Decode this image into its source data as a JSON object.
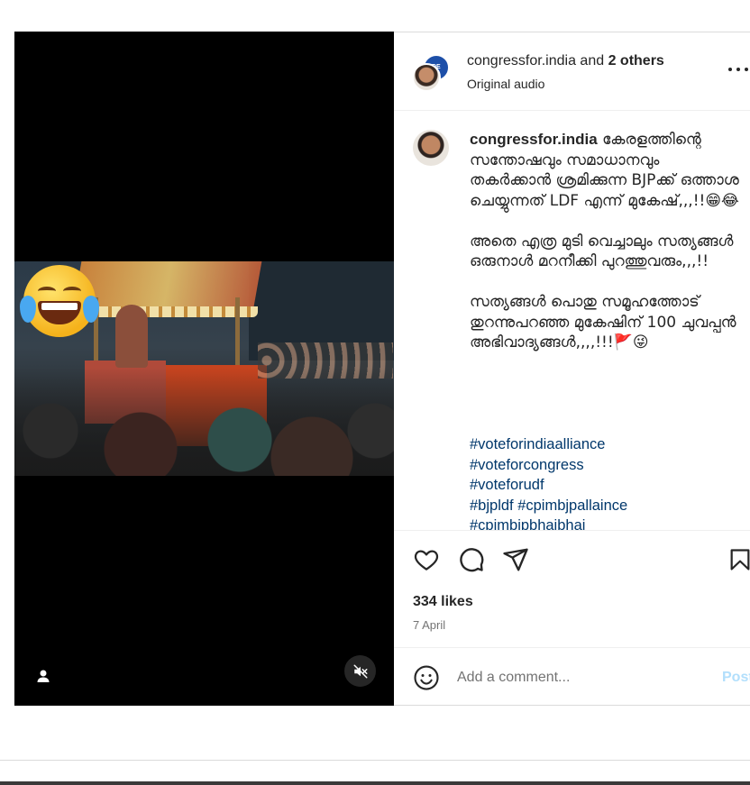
{
  "post": {
    "header": {
      "username": "congressfor.india",
      "joiner": "and",
      "others": "2 others",
      "audio": "Original audio",
      "more_icon": "more-horizontal-icon"
    },
    "caption": {
      "username": "congressfor.india",
      "text": " കേരളത്തിന്റെ സന്തോഷവും സമാധാനവും തകർക്കാൻ ശ്രമിക്കുന്ന BJPക്ക് ഒത്താശ ചെയ്യുന്നത് LDF എന്ന് മുകേഷ്,,,!!😁😂\n\nഅതെ എത്ര മുടി വെച്ചാലും സത്യങ്ങൾ ഒരുനാൾ മറനീക്കി പുറത്തുവരും,,,!!\n\nസത്യങ്ങൾ പൊതു സമൂഹത്തോട് തുറന്നുപറഞ്ഞ മുകേഷിന് 100 ചുവപ്പൻ അഭിവാദ്യങ്ങൾ,,,,!!!🚩😜",
      "hashtags": [
        "#voteforindiaalliance",
        "#voteforcongress",
        "#voteforudf",
        "#bjpldf #cpimbjpallaince",
        "#cpimbjpbhaibhai"
      ]
    },
    "video": {
      "overlay_emoji": "😂",
      "icons": [
        "user-tag-icon",
        "muted-speaker-icon"
      ]
    },
    "actions": {
      "icons": [
        "heart-icon",
        "comment-icon",
        "share-icon",
        "bookmark-icon"
      ]
    },
    "likes": "334 likes",
    "date": "7 April",
    "comment": {
      "placeholder": "Add a comment...",
      "post_label": "Post"
    }
  },
  "colors": {
    "hashtag": "#00376b",
    "post_button": "#b2dffc",
    "muted_text": "#737373"
  }
}
